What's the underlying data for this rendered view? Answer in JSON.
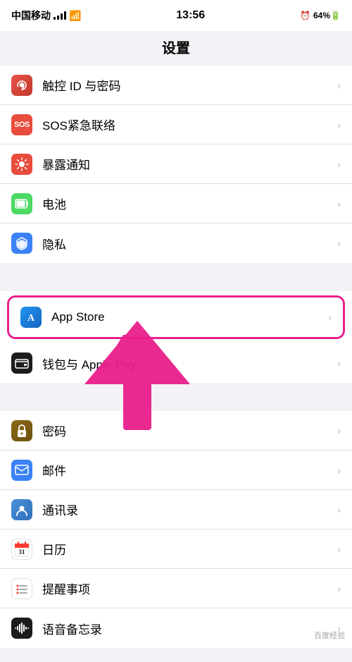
{
  "statusBar": {
    "carrier": "中国移动",
    "time": "13:56",
    "battery": "64%"
  },
  "navTitle": "设置",
  "groups": [
    {
      "id": "group1",
      "rows": [
        {
          "id": "touch-id",
          "iconClass": "icon-touch-id",
          "iconText": "👆",
          "label": "触控 ID 与密码",
          "highlighted": false
        },
        {
          "id": "sos",
          "iconClass": "icon-sos",
          "iconText": "SOS",
          "label": "SOS紧急联络",
          "highlighted": false
        },
        {
          "id": "exposure",
          "iconClass": "icon-exposure",
          "iconText": "☀",
          "label": "暴露通知",
          "highlighted": false
        },
        {
          "id": "battery",
          "iconClass": "icon-battery",
          "iconText": "🔋",
          "label": "电池",
          "highlighted": false
        },
        {
          "id": "privacy",
          "iconClass": "icon-privacy",
          "iconText": "✋",
          "label": "隐私",
          "highlighted": false
        }
      ]
    },
    {
      "id": "group2",
      "rows": [
        {
          "id": "appstore",
          "iconClass": "icon-appstore",
          "iconText": "A",
          "label": "App Store",
          "highlighted": true
        },
        {
          "id": "wallet",
          "iconClass": "icon-wallet",
          "iconText": "💳",
          "label": "钱包与 Apple Pay",
          "highlighted": false
        }
      ]
    },
    {
      "id": "group3",
      "rows": [
        {
          "id": "password",
          "iconClass": "icon-password",
          "iconText": "🔑",
          "label": "密码",
          "highlighted": false
        },
        {
          "id": "mail",
          "iconClass": "icon-mail",
          "iconText": "✉",
          "label": "邮件",
          "highlighted": false
        },
        {
          "id": "contacts",
          "iconClass": "icon-contacts",
          "iconText": "👤",
          "label": "通讯录",
          "highlighted": false
        },
        {
          "id": "calendar",
          "iconClass": "icon-calendar",
          "iconText": "📅",
          "label": "日历",
          "highlighted": false
        },
        {
          "id": "reminders",
          "iconClass": "icon-reminders",
          "iconText": "•••",
          "label": "提醒事项",
          "highlighted": false
        },
        {
          "id": "voice-memos",
          "iconClass": "icon-voice-memos",
          "iconText": "🎙",
          "label": "语音备忘录",
          "highlighted": false
        }
      ]
    }
  ],
  "arrow": {
    "visible": true,
    "color": "#e91e8c"
  }
}
